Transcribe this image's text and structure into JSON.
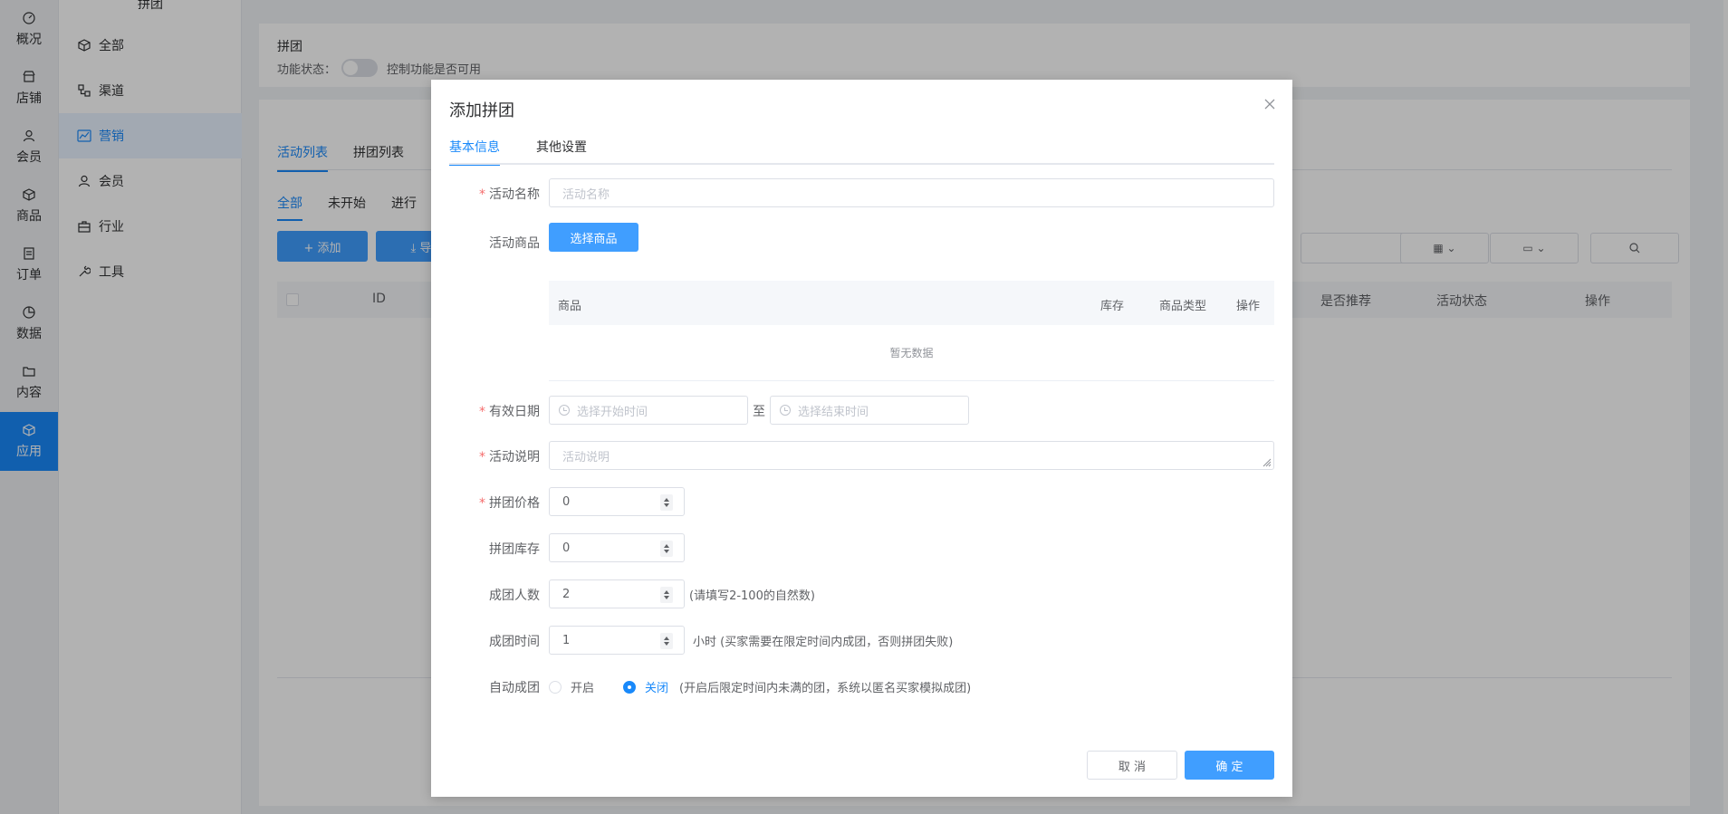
{
  "rail": {
    "items": [
      {
        "label": "概况",
        "icon": "dashboard-icon"
      },
      {
        "label": "店铺",
        "icon": "store-icon"
      },
      {
        "label": "会员",
        "icon": "user-icon"
      },
      {
        "label": "商品",
        "icon": "box-icon"
      },
      {
        "label": "订单",
        "icon": "order-icon"
      },
      {
        "label": "数据",
        "icon": "pie-icon"
      },
      {
        "label": "内容",
        "icon": "folder-icon"
      },
      {
        "label": "应用",
        "icon": "app-icon",
        "active": true
      }
    ]
  },
  "subnav": {
    "title": "拼团",
    "items": [
      {
        "label": "全部",
        "icon": "cube-icon"
      },
      {
        "label": "渠道",
        "icon": "channel-icon"
      },
      {
        "label": "营销",
        "icon": "chart-icon",
        "active": true
      },
      {
        "label": "会员",
        "icon": "user-icon"
      },
      {
        "label": "行业",
        "icon": "briefcase-icon"
      },
      {
        "label": "工具",
        "icon": "wrench-icon"
      }
    ]
  },
  "page": {
    "title": "拼团",
    "status_label": "功能状态：",
    "status_hint": "控制功能是否可用",
    "tabs": [
      "活动列表",
      "拼团列表"
    ],
    "subtabs": [
      "全部",
      "未开始",
      "进行"
    ],
    "add_button": "+ 添加",
    "export_button": "⤓ 导",
    "table_headers": {
      "id": "ID",
      "recommend": "是否推荐",
      "status": "活动状态",
      "action": "操作"
    }
  },
  "dialog": {
    "title": "添加拼团",
    "tabs": [
      "基本信息",
      "其他设置"
    ],
    "fields": {
      "name_label": "活动名称",
      "name_placeholder": "活动名称",
      "goods_label": "活动商品",
      "select_goods": "选择商品",
      "goods_table": {
        "col1": "商品",
        "col2": "库存",
        "col3": "商品类型",
        "col4": "操作",
        "empty": "暂无数据"
      },
      "date_label": "有效日期",
      "start_placeholder": "选择开始时间",
      "to": "至",
      "end_placeholder": "选择结束时间",
      "desc_label": "活动说明",
      "desc_placeholder": "活动说明",
      "price_label": "拼团价格",
      "price_value": "0",
      "stock_label": "拼团库存",
      "stock_value": "0",
      "size_label": "成团人数",
      "size_value": "2",
      "size_hint": "(请填写2-100的自然数)",
      "time_label": "成团时间",
      "time_value": "1",
      "time_hint": "小时 (买家需要在限定时间内成团，否则拼团失败)",
      "auto_label": "自动成团",
      "auto_on": "开启",
      "auto_off": "关闭",
      "auto_hint": "(开启后限定时间内未满的团，系统以匿名买家模拟成团)",
      "auto_selected": "关闭"
    },
    "cancel": "取 消",
    "confirm": "确 定"
  },
  "colors": {
    "primary": "#409eff",
    "active": "#1989fa",
    "required": "#f56c6c"
  }
}
